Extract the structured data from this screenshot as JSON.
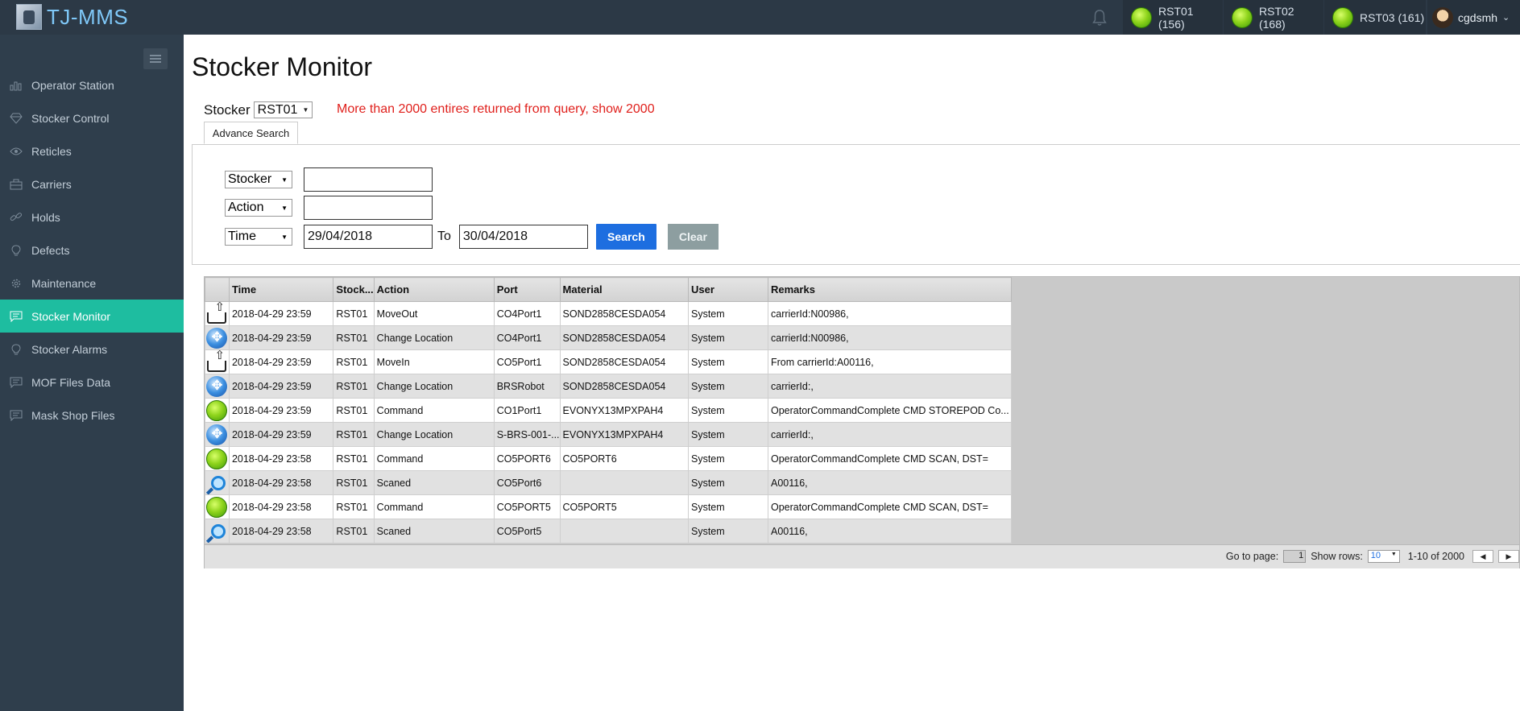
{
  "app": {
    "title": "TJ-MMS"
  },
  "header": {
    "stations": [
      {
        "label": "RST01 (156)"
      },
      {
        "label": "RST02 (168)"
      },
      {
        "label": "RST03 (161)"
      }
    ],
    "user": "cgdsmh"
  },
  "sidebar": {
    "items": [
      {
        "label": "Operator Station",
        "icon": "bar-chart-icon"
      },
      {
        "label": "Stocker Control",
        "icon": "diamond-icon"
      },
      {
        "label": "Reticles",
        "icon": "eye-icon"
      },
      {
        "label": "Carriers",
        "icon": "briefcase-icon"
      },
      {
        "label": "Holds",
        "icon": "link-icon"
      },
      {
        "label": "Defects",
        "icon": "lightbulb-icon"
      },
      {
        "label": "Maintenance",
        "icon": "gear-icon"
      },
      {
        "label": "Stocker Monitor",
        "icon": "comment-icon",
        "active": true
      },
      {
        "label": "Stocker Alarms",
        "icon": "lightbulb-icon"
      },
      {
        "label": "MOF Files Data",
        "icon": "comment-icon"
      },
      {
        "label": "Mask Shop Files",
        "icon": "comment-icon"
      }
    ]
  },
  "page": {
    "title": "Stocker Monitor",
    "stocker_label": "Stocker",
    "stocker_value": "RST01",
    "warning": "More than 2000 entires returned from query, show 2000",
    "advance_tab": "Advance Search"
  },
  "filters": {
    "stocker_field": "Stocker",
    "stocker_value": "",
    "action_field": "Action",
    "action_value": "",
    "time_field": "Time",
    "time_from": "29/04/2018",
    "to_label": "To",
    "time_to": "30/04/2018",
    "search_label": "Search",
    "clear_label": "Clear"
  },
  "grid": {
    "columns": [
      "Time",
      "Stock...",
      "Action",
      "Port",
      "Material",
      "User",
      "Remarks"
    ],
    "rows": [
      {
        "icon": "move-out-icon",
        "time": "2018-04-29 23:59",
        "stocker": "RST01",
        "action": "MoveOut",
        "port": "CO4Port1",
        "material": "SOND2858CESDA054",
        "user": "System",
        "remarks": "carrierId:N00986,"
      },
      {
        "icon": "change-location-icon",
        "time": "2018-04-29 23:59",
        "stocker": "RST01",
        "action": "Change Location",
        "port": "CO4Port1",
        "material": "SOND2858CESDA054",
        "user": "System",
        "remarks": "carrierId:N00986,"
      },
      {
        "icon": "move-in-icon",
        "time": "2018-04-29 23:59",
        "stocker": "RST01",
        "action": "MoveIn",
        "port": "CO5Port1",
        "material": "SOND2858CESDA054",
        "user": "System",
        "remarks": "From carrierId:A00116,"
      },
      {
        "icon": "change-location-icon",
        "time": "2018-04-29 23:59",
        "stocker": "RST01",
        "action": "Change Location",
        "port": "BRSRobot",
        "material": "SOND2858CESDA054",
        "user": "System",
        "remarks": "carrierId:,"
      },
      {
        "icon": "command-icon",
        "time": "2018-04-29 23:59",
        "stocker": "RST01",
        "action": "Command",
        "port": "CO1Port1",
        "material": "EVONYX13MPXPAH4",
        "user": "System",
        "remarks": "OperatorCommandComplete CMD STOREPOD Co..."
      },
      {
        "icon": "change-location-icon",
        "time": "2018-04-29 23:59",
        "stocker": "RST01",
        "action": "Change Location",
        "port": "S-BRS-001-...",
        "material": "EVONYX13MPXPAH4",
        "user": "System",
        "remarks": "carrierId:,"
      },
      {
        "icon": "command-icon",
        "time": "2018-04-29 23:58",
        "stocker": "RST01",
        "action": "Command",
        "port": "CO5PORT6",
        "material": "CO5PORT6",
        "user": "System",
        "remarks": "OperatorCommandComplete CMD SCAN, DST="
      },
      {
        "icon": "scan-icon",
        "time": "2018-04-29 23:58",
        "stocker": "RST01",
        "action": "Scaned",
        "port": "CO5Port6",
        "material": "",
        "user": "System",
        "remarks": "A00116,"
      },
      {
        "icon": "command-icon",
        "time": "2018-04-29 23:58",
        "stocker": "RST01",
        "action": "Command",
        "port": "CO5PORT5",
        "material": "CO5PORT5",
        "user": "System",
        "remarks": "OperatorCommandComplete CMD SCAN, DST="
      },
      {
        "icon": "scan-icon",
        "time": "2018-04-29 23:58",
        "stocker": "RST01",
        "action": "Scaned",
        "port": "CO5Port5",
        "material": "",
        "user": "System",
        "remarks": "A00116,"
      }
    ]
  },
  "pager": {
    "goto_label": "Go to page:",
    "page": "1",
    "rows_label": "Show rows:",
    "rows_value": "10",
    "range": "1-10 of 2000",
    "prev": "◀",
    "next": "▶"
  },
  "colors": {
    "accent": "#1ebda0",
    "topbar": "#2c3946",
    "sidebar": "#2f3e4c",
    "warning": "#e0201c",
    "search": "#1d6ee0"
  }
}
